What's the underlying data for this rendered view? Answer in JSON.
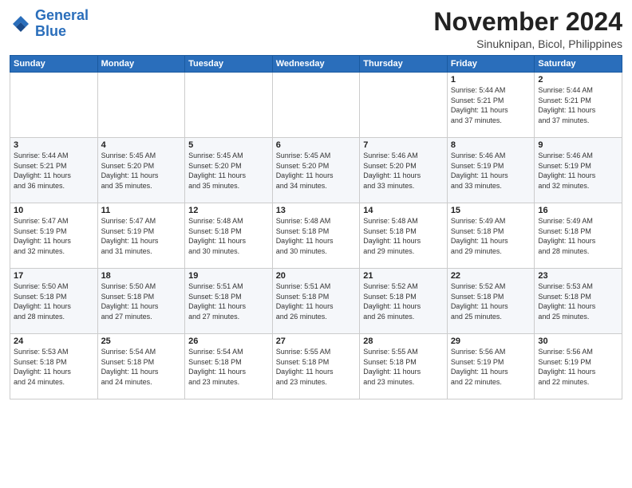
{
  "logo": {
    "line1": "General",
    "line2": "Blue"
  },
  "title": "November 2024",
  "location": "Sinuknipan, Bicol, Philippines",
  "days_of_week": [
    "Sunday",
    "Monday",
    "Tuesday",
    "Wednesday",
    "Thursday",
    "Friday",
    "Saturday"
  ],
  "weeks": [
    [
      {
        "day": "",
        "info": ""
      },
      {
        "day": "",
        "info": ""
      },
      {
        "day": "",
        "info": ""
      },
      {
        "day": "",
        "info": ""
      },
      {
        "day": "",
        "info": ""
      },
      {
        "day": "1",
        "info": "Sunrise: 5:44 AM\nSunset: 5:21 PM\nDaylight: 11 hours\nand 37 minutes."
      },
      {
        "day": "2",
        "info": "Sunrise: 5:44 AM\nSunset: 5:21 PM\nDaylight: 11 hours\nand 37 minutes."
      }
    ],
    [
      {
        "day": "3",
        "info": "Sunrise: 5:44 AM\nSunset: 5:21 PM\nDaylight: 11 hours\nand 36 minutes."
      },
      {
        "day": "4",
        "info": "Sunrise: 5:45 AM\nSunset: 5:20 PM\nDaylight: 11 hours\nand 35 minutes."
      },
      {
        "day": "5",
        "info": "Sunrise: 5:45 AM\nSunset: 5:20 PM\nDaylight: 11 hours\nand 35 minutes."
      },
      {
        "day": "6",
        "info": "Sunrise: 5:45 AM\nSunset: 5:20 PM\nDaylight: 11 hours\nand 34 minutes."
      },
      {
        "day": "7",
        "info": "Sunrise: 5:46 AM\nSunset: 5:20 PM\nDaylight: 11 hours\nand 33 minutes."
      },
      {
        "day": "8",
        "info": "Sunrise: 5:46 AM\nSunset: 5:19 PM\nDaylight: 11 hours\nand 33 minutes."
      },
      {
        "day": "9",
        "info": "Sunrise: 5:46 AM\nSunset: 5:19 PM\nDaylight: 11 hours\nand 32 minutes."
      }
    ],
    [
      {
        "day": "10",
        "info": "Sunrise: 5:47 AM\nSunset: 5:19 PM\nDaylight: 11 hours\nand 32 minutes."
      },
      {
        "day": "11",
        "info": "Sunrise: 5:47 AM\nSunset: 5:19 PM\nDaylight: 11 hours\nand 31 minutes."
      },
      {
        "day": "12",
        "info": "Sunrise: 5:48 AM\nSunset: 5:18 PM\nDaylight: 11 hours\nand 30 minutes."
      },
      {
        "day": "13",
        "info": "Sunrise: 5:48 AM\nSunset: 5:18 PM\nDaylight: 11 hours\nand 30 minutes."
      },
      {
        "day": "14",
        "info": "Sunrise: 5:48 AM\nSunset: 5:18 PM\nDaylight: 11 hours\nand 29 minutes."
      },
      {
        "day": "15",
        "info": "Sunrise: 5:49 AM\nSunset: 5:18 PM\nDaylight: 11 hours\nand 29 minutes."
      },
      {
        "day": "16",
        "info": "Sunrise: 5:49 AM\nSunset: 5:18 PM\nDaylight: 11 hours\nand 28 minutes."
      }
    ],
    [
      {
        "day": "17",
        "info": "Sunrise: 5:50 AM\nSunset: 5:18 PM\nDaylight: 11 hours\nand 28 minutes."
      },
      {
        "day": "18",
        "info": "Sunrise: 5:50 AM\nSunset: 5:18 PM\nDaylight: 11 hours\nand 27 minutes."
      },
      {
        "day": "19",
        "info": "Sunrise: 5:51 AM\nSunset: 5:18 PM\nDaylight: 11 hours\nand 27 minutes."
      },
      {
        "day": "20",
        "info": "Sunrise: 5:51 AM\nSunset: 5:18 PM\nDaylight: 11 hours\nand 26 minutes."
      },
      {
        "day": "21",
        "info": "Sunrise: 5:52 AM\nSunset: 5:18 PM\nDaylight: 11 hours\nand 26 minutes."
      },
      {
        "day": "22",
        "info": "Sunrise: 5:52 AM\nSunset: 5:18 PM\nDaylight: 11 hours\nand 25 minutes."
      },
      {
        "day": "23",
        "info": "Sunrise: 5:53 AM\nSunset: 5:18 PM\nDaylight: 11 hours\nand 25 minutes."
      }
    ],
    [
      {
        "day": "24",
        "info": "Sunrise: 5:53 AM\nSunset: 5:18 PM\nDaylight: 11 hours\nand 24 minutes."
      },
      {
        "day": "25",
        "info": "Sunrise: 5:54 AM\nSunset: 5:18 PM\nDaylight: 11 hours\nand 24 minutes."
      },
      {
        "day": "26",
        "info": "Sunrise: 5:54 AM\nSunset: 5:18 PM\nDaylight: 11 hours\nand 23 minutes."
      },
      {
        "day": "27",
        "info": "Sunrise: 5:55 AM\nSunset: 5:18 PM\nDaylight: 11 hours\nand 23 minutes."
      },
      {
        "day": "28",
        "info": "Sunrise: 5:55 AM\nSunset: 5:18 PM\nDaylight: 11 hours\nand 23 minutes."
      },
      {
        "day": "29",
        "info": "Sunrise: 5:56 AM\nSunset: 5:19 PM\nDaylight: 11 hours\nand 22 minutes."
      },
      {
        "day": "30",
        "info": "Sunrise: 5:56 AM\nSunset: 5:19 PM\nDaylight: 11 hours\nand 22 minutes."
      }
    ]
  ]
}
